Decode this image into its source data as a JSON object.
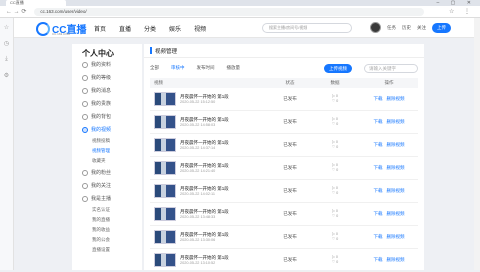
{
  "browser": {
    "tab_title": "CC直播",
    "window_controls": "– ▢ ✕",
    "url": "cc.163.com/user/video/",
    "nav_icons": "← → ⟳",
    "right_icons": "☆ ⋮"
  },
  "site": {
    "logo": "CC直播",
    "logo_sub": "CC.163.COM"
  },
  "topnav": [
    "首页",
    "直播",
    "分类",
    "娱乐",
    "视频"
  ],
  "search": {
    "placeholder": "搜索主播/房间号/视频"
  },
  "user": {
    "task": "任务",
    "history": "历史",
    "follow": "关注",
    "upload": "上传"
  },
  "leftnav": {
    "title": "个人中心",
    "items": [
      {
        "label": "我的资料"
      },
      {
        "label": "我的等级"
      },
      {
        "label": "我的消息"
      },
      {
        "label": "我的贵族"
      },
      {
        "label": "我的背包"
      },
      {
        "label": "我的视频",
        "active": true
      }
    ],
    "subitems_1": [
      {
        "label": "视频投稿"
      },
      {
        "label": "视频管理",
        "active": true
      },
      {
        "label": "收藏夹"
      }
    ],
    "items_2": [
      {
        "label": "我的粉丝"
      },
      {
        "label": "我的关注"
      },
      {
        "label": "我是主播"
      }
    ],
    "subitems_2": [
      {
        "label": "实名认证"
      },
      {
        "label": "我的直播"
      },
      {
        "label": "我的收益"
      },
      {
        "label": "我的公会"
      },
      {
        "label": "直播设置"
      }
    ]
  },
  "main": {
    "title": "视频管理",
    "filters": [
      "全部",
      "审核中",
      "发布时间",
      "播放量"
    ],
    "upload_button": "上传视频",
    "keyword_placeholder": "请输入关键字",
    "columns": [
      "视频",
      "状态",
      "数据",
      "操作"
    ],
    "rows": [
      {
        "title": "月夜晨怀一开始的 第1段",
        "time": "2020-05-22 15:12:50",
        "status": "已发布",
        "plays": "0",
        "likes": "0",
        "op1": "下载",
        "op2": "删除视频"
      },
      {
        "title": "月夜晨怀一开始的 第1段",
        "time": "2020-05-22 14:58:03",
        "status": "已发布",
        "plays": "0",
        "likes": "0",
        "op1": "下载",
        "op2": "删除视频"
      },
      {
        "title": "月夜晨怀一开始的 第1段",
        "time": "2020-05-22 14:37:14",
        "status": "已发布",
        "plays": "0",
        "likes": "0",
        "op1": "下载",
        "op2": "删除视频"
      },
      {
        "title": "月夜晨怀一开始的 第1段",
        "time": "2020-05-22 14:21:40",
        "status": "已发布",
        "plays": "0",
        "likes": "0",
        "op1": "下载",
        "op2": "删除视频"
      },
      {
        "title": "月夜晨怀一开始的 第1段",
        "time": "2020-05-22 14:02:11",
        "status": "已发布",
        "plays": "0",
        "likes": "0",
        "op1": "下载",
        "op2": "删除视频"
      },
      {
        "title": "月夜晨怀一开始的 第1段",
        "time": "2020-05-22 13:48:33",
        "status": "已发布",
        "plays": "0",
        "likes": "0",
        "op1": "下载",
        "op2": "删除视频"
      },
      {
        "title": "月夜晨怀一开始的 第1段",
        "time": "2020-05-22 13:30:06",
        "status": "已发布",
        "plays": "0",
        "likes": "0",
        "op1": "下载",
        "op2": "删除视频"
      },
      {
        "title": "月夜晨怀一开始的 第1段",
        "time": "2020-05-22 13:10:52",
        "status": "已发布",
        "plays": "0",
        "likes": "0",
        "op1": "下载",
        "op2": "删除视频"
      }
    ]
  },
  "colors": {
    "accent": "#1677ff"
  }
}
